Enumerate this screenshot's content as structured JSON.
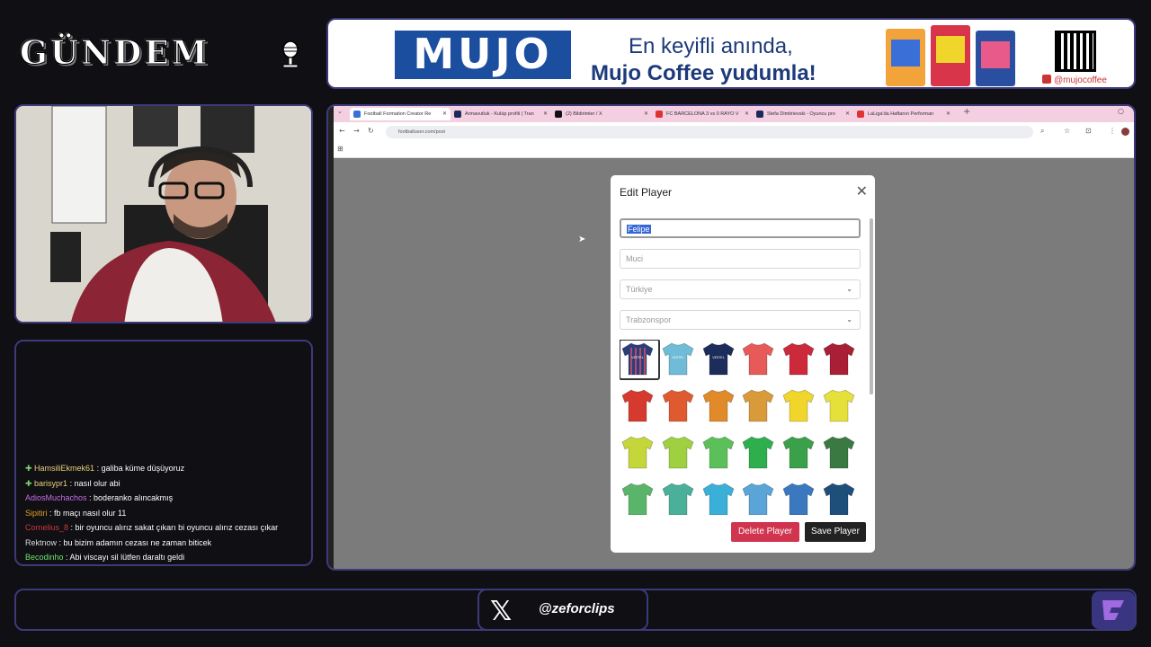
{
  "stream": {
    "logo_text": "GÜNDEM",
    "ad": {
      "brand": "MUJO",
      "line1": "En keyifli anında,",
      "line2": "Mujo Coffee yudumla!",
      "social": "@mujocoffee"
    },
    "social_handle": "@zeforclips"
  },
  "chat": [
    {
      "user": "HamsiliEkmek61",
      "text": ": galiba küme düşüyoruz",
      "color": "#e8d27a",
      "badge": true
    },
    {
      "user": "barisypr1",
      "text": ": nasıl olur abi",
      "color": "#e8d27a",
      "badge": true
    },
    {
      "user": "AdiosMuchachos",
      "text": ": boderanko alıncakmış",
      "color": "#c46fe0",
      "badge": false
    },
    {
      "user": "Sipitiri",
      "text": ": fb maçı nasıl olur 11",
      "color": "#e0a020",
      "badge": false
    },
    {
      "user": "Cornelius_8",
      "text": ": bir oyuncu alırız sakat çıkarı bi oyuncu alırız cezası çıkar",
      "color": "#cc3a3a",
      "badge": false
    },
    {
      "user": "Rektnow",
      "text": ": bu bizim adamın cezası ne zaman biticek",
      "color": "#dddddd",
      "badge": false
    },
    {
      "user": "Becodinho",
      "text": ": Abi viscayı sil lütfen daraltı geldi",
      "color": "#6fe06f",
      "badge": false
    }
  ],
  "browser": {
    "tabs": [
      {
        "title": "Football Formation Creator Re",
        "active": true,
        "fav": "#3a6fd8"
      },
      {
        "title": "Armavutluk - Kulüp profili | Tran",
        "active": false,
        "fav": "#1b2a5a"
      },
      {
        "title": "(2) Bildirimler / X",
        "active": false,
        "fav": "#111111"
      },
      {
        "title": "FC BARCELONA 3 vs 0 RAYO V",
        "active": false,
        "fav": "#d33"
      },
      {
        "title": "Stefa Dimitrievski - Oyuncu pro",
        "active": false,
        "fav": "#1b2a5a"
      },
      {
        "title": "LaLiga'da Haftanın Performan",
        "active": false,
        "fav": "#d33"
      }
    ],
    "url": "footballuser.com/post"
  },
  "modal": {
    "title": "Edit Player",
    "first_name": "Felipe",
    "last_name_placeholder": "Muci",
    "country": "Türkiye",
    "club": "Trabzonspor",
    "delete_label": "Delete Player",
    "save_label": "Save Player",
    "selected_jersey_index": 0
  },
  "colors": {
    "accent_frame": "#3d3a7a",
    "delete": "#d0344e",
    "save": "#222222"
  },
  "jerseys": [
    {
      "color": "#2a3f7a",
      "stripe": "#b44a6a",
      "label": "VESTEL"
    },
    {
      "color": "#6fbcd8",
      "stripe": "",
      "label": "VESTEL"
    },
    {
      "color": "#1c2d5c",
      "stripe": "",
      "label": "VESTEL"
    },
    {
      "color": "#e85a5a",
      "stripe": "",
      "label": ""
    },
    {
      "color": "#cc2a3a",
      "stripe": "",
      "label": ""
    },
    {
      "color": "#a81f36",
      "stripe": "",
      "label": ""
    },
    {
      "color": "#d6392e",
      "stripe": "",
      "label": ""
    },
    {
      "color": "#e05a30",
      "stripe": "",
      "label": ""
    },
    {
      "color": "#e08a2a",
      "stripe": "",
      "label": ""
    },
    {
      "color": "#d99a3a",
      "stripe": "",
      "label": ""
    },
    {
      "color": "#f0d62a",
      "stripe": "",
      "label": ""
    },
    {
      "color": "#e6e03a",
      "stripe": "",
      "label": ""
    },
    {
      "color": "#c4d63a",
      "stripe": "",
      "label": ""
    },
    {
      "color": "#9ed040",
      "stripe": "",
      "label": ""
    },
    {
      "color": "#5cc05a",
      "stripe": "",
      "label": ""
    },
    {
      "color": "#2fae4e",
      "stripe": "",
      "label": ""
    },
    {
      "color": "#3aa04a",
      "stripe": "",
      "label": ""
    },
    {
      "color": "#3a7a42",
      "stripe": "",
      "label": ""
    },
    {
      "color": "#5ab56a",
      "stripe": "",
      "label": ""
    },
    {
      "color": "#4ab09a",
      "stripe": "",
      "label": ""
    },
    {
      "color": "#3ab0d8",
      "stripe": "",
      "label": ""
    },
    {
      "color": "#5aa4d8",
      "stripe": "",
      "label": ""
    },
    {
      "color": "#3a78c0",
      "stripe": "",
      "label": ""
    },
    {
      "color": "#1e4e7a",
      "stripe": "",
      "label": ""
    }
  ]
}
